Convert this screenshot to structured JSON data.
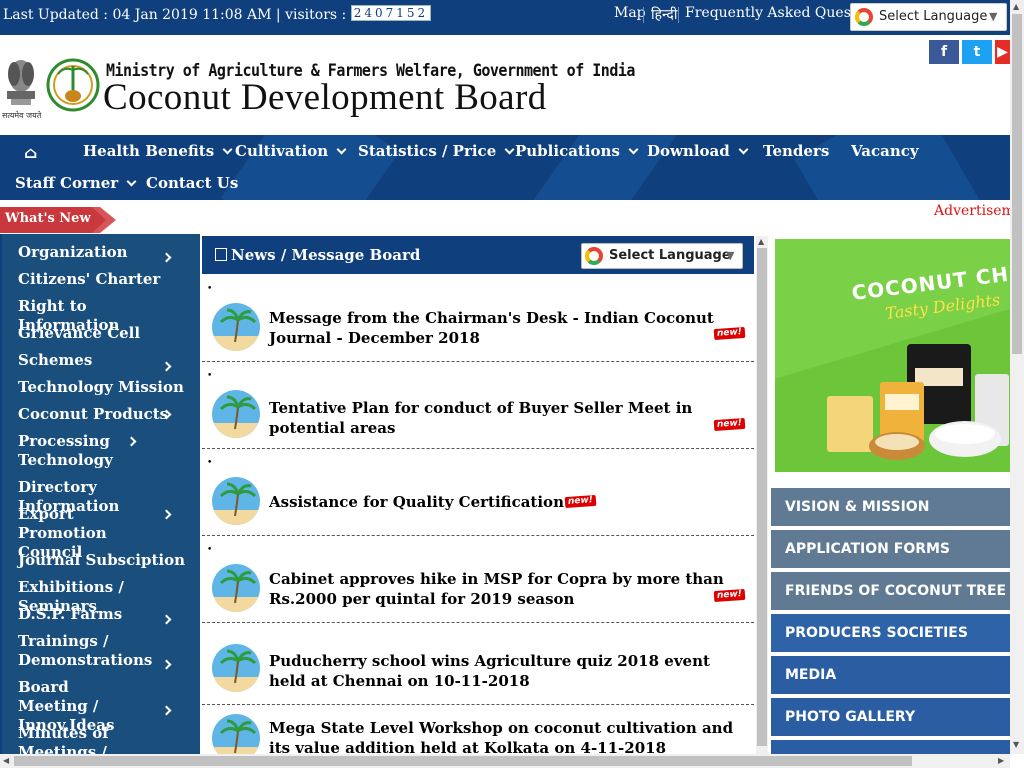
{
  "topbar": {
    "updated_prefix": "Last Updated : 04 Jan 2019 11:08 AM | visitors : ",
    "visitor_count": "2407152",
    "links": [
      "Map",
      "हिन्दी",
      "Frequently Asked Questions"
    ],
    "translate_label": "Select Language",
    "translate_arrow": "▼"
  },
  "header": {
    "ministry": "Ministry of Agriculture & Farmers Welfare, Government of India",
    "board": "Coconut Development Board",
    "motto": "सत्यमेव जयते",
    "social": [
      "facebook-icon",
      "twitter-icon",
      "youtube-icon"
    ],
    "social_glyphs": [
      "f",
      "t",
      "▶"
    ]
  },
  "nav": {
    "home_glyph": "⌂",
    "items": [
      {
        "label": "Health Benefits",
        "dropdown": true
      },
      {
        "label": "Cultivation",
        "dropdown": true
      },
      {
        "label": "Statistics / Price",
        "dropdown": true
      },
      {
        "label": "Publications",
        "dropdown": true
      },
      {
        "label": "Download",
        "dropdown": true
      },
      {
        "label": "Tenders",
        "dropdown": false
      },
      {
        "label": "Vacancy",
        "dropdown": false
      },
      {
        "label": "Staff Corner",
        "dropdown": true
      },
      {
        "label": "Contact Us",
        "dropdown": false
      }
    ]
  },
  "ticker": {
    "whats_new": "What's New",
    "advertisement": "Advertisement"
  },
  "sidebar": {
    "items": [
      {
        "label": "Organization",
        "sub": true
      },
      {
        "label": "Citizens' Charter",
        "sub": false
      },
      {
        "label": "Right to Information",
        "sub": false
      },
      {
        "label": "Grievance Cell",
        "sub": false
      },
      {
        "label": "Schemes",
        "sub": true
      },
      {
        "label": "Technology Mission",
        "sub": false
      },
      {
        "label": "Coconut Products",
        "sub": true
      },
      {
        "label": "Processing Technology",
        "sub": true
      },
      {
        "label": "Directory Information",
        "sub": false
      },
      {
        "label": "Export Promotion Council",
        "sub": true
      },
      {
        "label": "Journal Subsciption",
        "sub": false
      },
      {
        "label": "Exhibitions / Seminars",
        "sub": false
      },
      {
        "label": "D.S.P. Farms",
        "sub": true
      },
      {
        "label": "Trainings / Demonstrations",
        "sub": true
      },
      {
        "label": "Board Meeting / Innov.Ideas",
        "sub": true
      },
      {
        "label": "Minutes of Meetings / Articles",
        "sub": false
      }
    ]
  },
  "news": {
    "title": "News / Message Board",
    "translate_label": "Select Language",
    "translate_arrow": "▼",
    "bullet": "•",
    "new_badge": "new!",
    "items": [
      {
        "text": "Message from the Chairman's Desk - Indian Coconut Journal - December 2018",
        "is_new": true
      },
      {
        "text": "Tentative Plan for conduct of Buyer Seller Meet in potential areas",
        "is_new": true
      },
      {
        "text": "Assistance for Quality Certification",
        "is_new": true
      },
      {
        "text": "Cabinet approves hike in MSP for Copra by more than Rs.2000 per quintal for 2019 season",
        "is_new": true
      },
      {
        "text": "Puducherry school wins Agriculture quiz 2018 event held at Chennai on 10-11-2018",
        "is_new": false
      },
      {
        "text": "Mega State Level Workshop on coconut cultivation and its value addition held at Kolkata on 4-11-2018",
        "is_new": false
      }
    ]
  },
  "ad": {
    "title": "COCONUT CHIPS",
    "subtitle": "Tasty Delights"
  },
  "quicklinks": [
    {
      "label": "VISION & MISSION",
      "color": "#5f7a92"
    },
    {
      "label": "APPLICATION FORMS",
      "color": "#5f7a92"
    },
    {
      "label": "FRIENDS OF COCONUT TREE",
      "color": "#5f7a92"
    },
    {
      "label": "PRODUCERS SOCIETIES",
      "color": "#2f63a8"
    },
    {
      "label": "MEDIA",
      "color": "#2a5da2"
    },
    {
      "label": "PHOTO GALLERY",
      "color": "#2a5da2"
    },
    {
      "label": "",
      "color": "#2a5da2"
    }
  ],
  "colors": {
    "brand_blue": "#0f3f7c",
    "sidebar_blue": "#1a4e7d",
    "new_red": "#dd0000",
    "ad_green": "#6dc63a"
  }
}
